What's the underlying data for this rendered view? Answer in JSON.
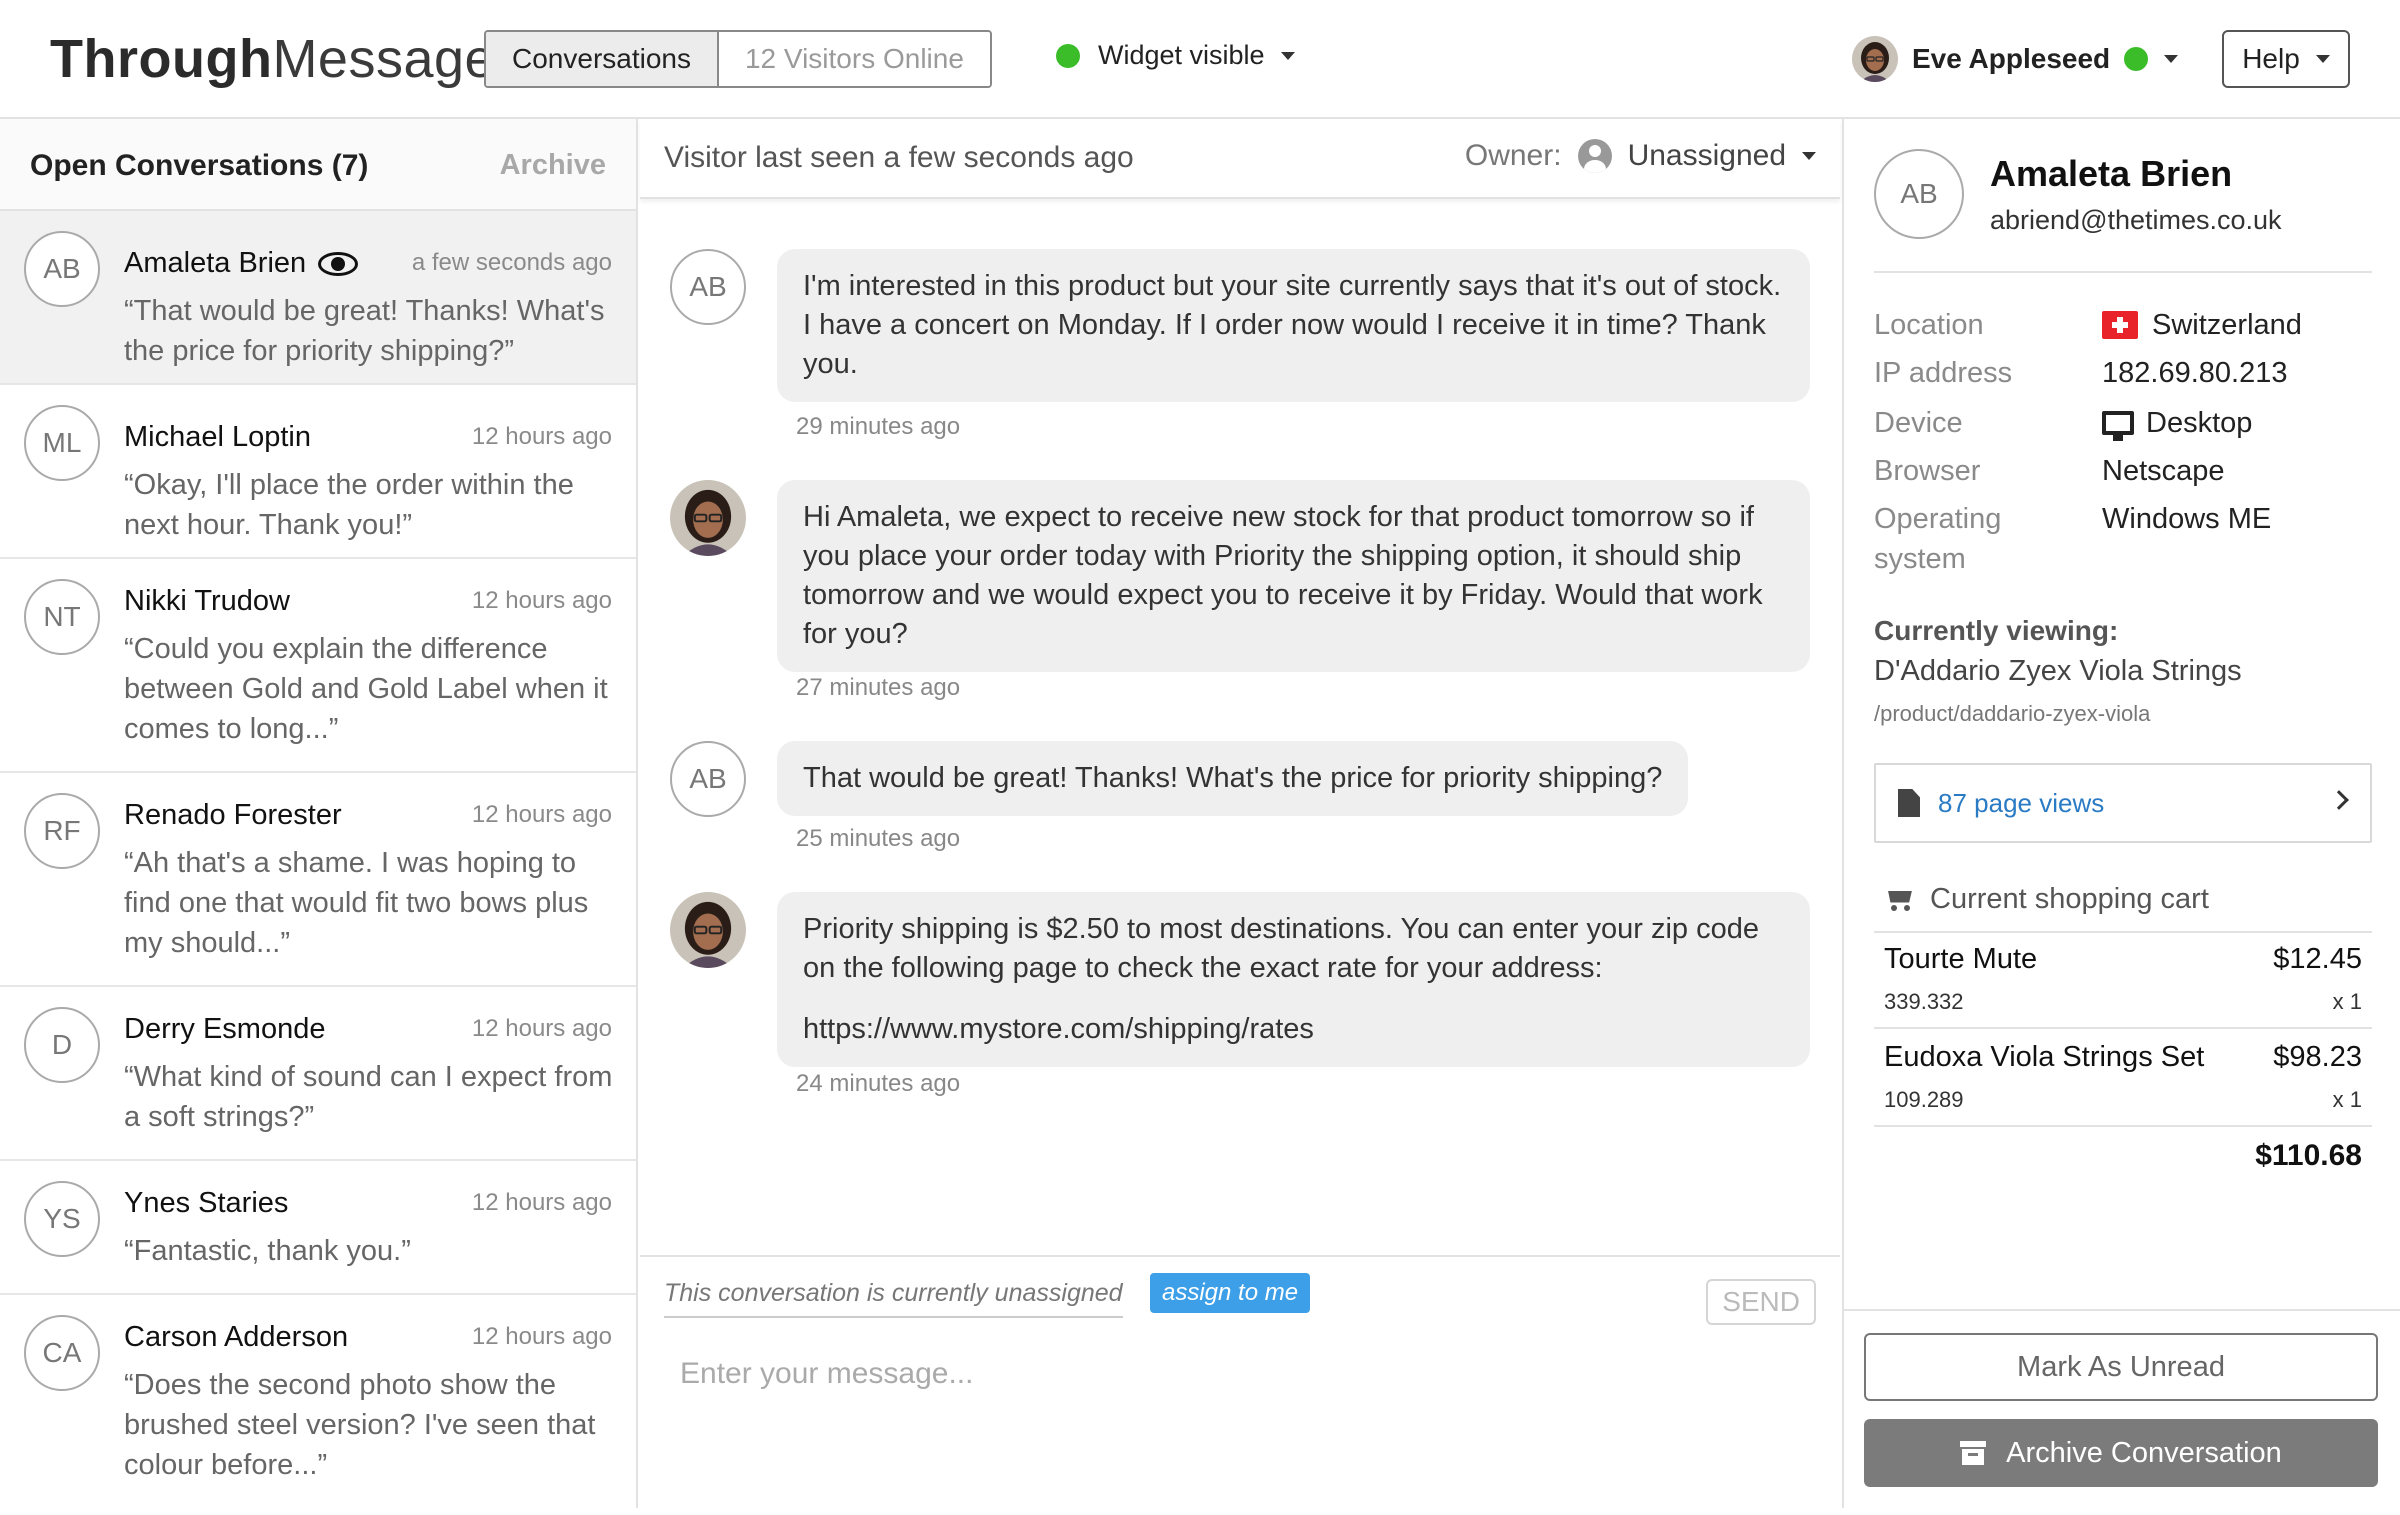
{
  "header": {
    "logo_bold": "Through",
    "logo_light": "Message",
    "tabs": [
      {
        "label": "Conversations",
        "active": true
      },
      {
        "label": "12 Visitors Online",
        "active": false
      }
    ],
    "widget_status": "Widget visible",
    "user_name": "Eve Appleseed",
    "help_label": "Help",
    "status_color": "#3bbd2a"
  },
  "sidebar": {
    "title": "Open Conversations (7)",
    "archive_label": "Archive",
    "conversations": [
      {
        "initials": "AB",
        "name": "Amaleta Brien",
        "time": "a few seconds ago",
        "message": "“That would be great! Thanks! What's the price for priority shipping?”",
        "selected": true,
        "watching_icon": "eye-icon"
      },
      {
        "initials": "ML",
        "name": "Michael Loptin",
        "time": "12 hours ago",
        "message": "“Okay, I'll place the order within the next hour. Thank you!”"
      },
      {
        "initials": "NT",
        "name": "Nikki Trudow",
        "time": "12 hours ago",
        "message": "“Could you explain the difference between Gold and Gold Label when it comes to long...”"
      },
      {
        "initials": "RF",
        "name": "Renado Forester",
        "time": "12 hours ago",
        "message": "“Ah that's a shame. I was hoping to find one that would fit two bows plus my should...”"
      },
      {
        "initials": "D",
        "name": "Derry Esmonde",
        "time": "12 hours ago",
        "message": "“What kind of sound can I expect from a soft strings?”"
      },
      {
        "initials": "YS",
        "name": "Ynes Staries",
        "time": "12 hours ago",
        "message": "“Fantastic, thank you.”"
      },
      {
        "initials": "CA",
        "name": "Carson Adderson",
        "time": "12 hours ago",
        "message": "“Does the second photo show the brushed steel version? I've seen that colour before...”"
      }
    ]
  },
  "chat": {
    "last_seen": "Visitor last seen a few seconds ago",
    "owner_label": "Owner:",
    "owner_value": "Unassigned",
    "messages": [
      {
        "from": "visitor",
        "initials": "AB",
        "text": "I'm interested in this product but your site currently says that it's out of stock. I have a concert on Monday. If I order now would I receive it in time? Thank you.",
        "time": "29 minutes ago"
      },
      {
        "from": "agent",
        "text": "Hi Amaleta, we expect to receive new stock for that product tomorrow so if you place your order today with Priority the shipping option, it should ship tomorrow and we would expect you to receive it by Friday. Would that work for you?",
        "time": "27 minutes ago"
      },
      {
        "from": "visitor",
        "initials": "AB",
        "text": "That would be great! Thanks! What's the price for priority shipping?",
        "time": "25 minutes ago"
      },
      {
        "from": "agent",
        "text": "Priority shipping is $2.50 to most destinations. You can enter your zip code on the following page to check the exact rate for your address:",
        "link": "https://www.mystore.com/shipping/rates",
        "time": "24 minutes ago"
      }
    ],
    "composer": {
      "unassigned_note": "This conversation is currently unassigned",
      "assign_label": "assign to me",
      "send_label": "SEND",
      "placeholder": "Enter your message..."
    }
  },
  "visitor": {
    "initials": "AB",
    "name": "Amaleta Brien",
    "email": "abriend@thetimes.co.uk",
    "meta": [
      {
        "label": "Location",
        "value": "Switzerland",
        "icon": "swiss-flag-icon"
      },
      {
        "label": "IP address",
        "value": "182.69.80.213"
      },
      {
        "label": "Device",
        "value": "Desktop",
        "icon": "desktop-icon"
      },
      {
        "label": "Browser",
        "value": "Netscape"
      },
      {
        "label": "Operating system",
        "value": "Windows ME"
      }
    ],
    "currently_viewing_label": "Currently viewing:",
    "currently_viewing_product": "D'Addario Zyex Viola Strings",
    "currently_viewing_path": "/product/daddario-zyex-viola",
    "page_views": "87 page views",
    "cart_label": "Current shopping cart",
    "cart_items": [
      {
        "name": "Tourte Mute",
        "price": "$12.45",
        "sku": "339.332",
        "qty": "x 1"
      },
      {
        "name": "Eudoxa Viola Strings Set",
        "price": "$98.23",
        "sku": "109.289",
        "qty": "x 1"
      }
    ],
    "cart_total": "$110.68",
    "mark_unread_label": "Mark As Unread",
    "archive_label": "Archive Conversation"
  }
}
